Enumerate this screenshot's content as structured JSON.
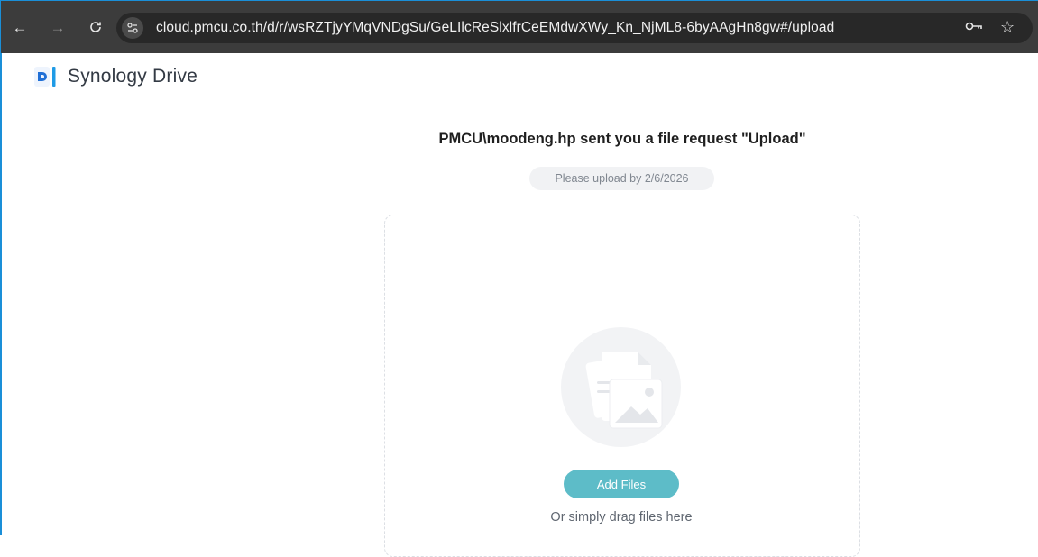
{
  "browser": {
    "url": "cloud.pmcu.co.th/d/r/wsRZTjyYMqVNDgSu/GeLIlcReSlxlfrCeEMdwXWy_Kn_NjML8-6byAAgHn8gw#/upload",
    "icons": [
      "back-arrow-icon",
      "forward-arrow-icon",
      "reload-icon",
      "site-info-icon",
      "key-icon",
      "star-icon"
    ]
  },
  "app": {
    "name": "Synology Drive",
    "accent": "#1f6fd6"
  },
  "request": {
    "title": "PMCU\\moodeng.hp sent you a file request \"Upload\"",
    "deadline": "Please upload by 2/6/2026"
  },
  "upload": {
    "button_label": "Add Files",
    "drag_hint": "Or simply drag files here",
    "button_color": "#5dbcc8"
  }
}
